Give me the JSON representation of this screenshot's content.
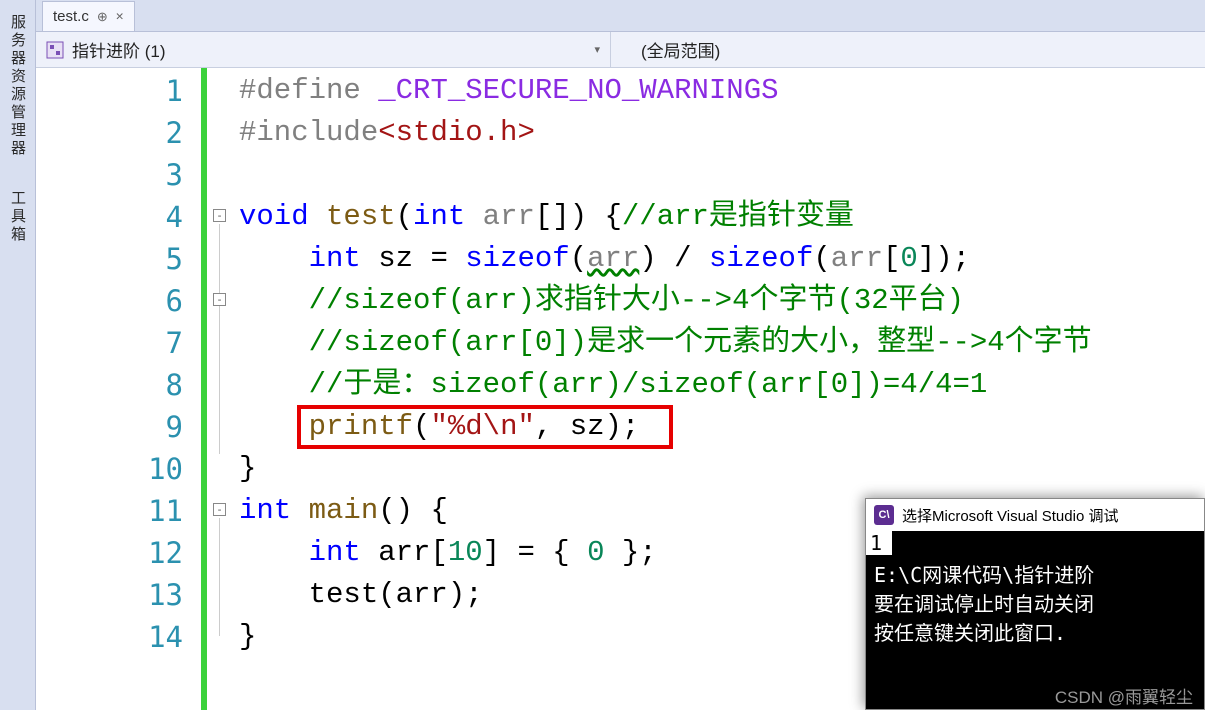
{
  "sidebar": {
    "items": [
      "服务器资源管理器",
      "工具箱"
    ]
  },
  "tab": {
    "filename": "test.c",
    "pin_glyph": "⊕",
    "close_glyph": "✕"
  },
  "navbar": {
    "left": "指针进阶 (1)",
    "right": "(全局范围)"
  },
  "code": {
    "lines": [
      1,
      2,
      3,
      4,
      5,
      6,
      7,
      8,
      9,
      10,
      11,
      12,
      13,
      14
    ],
    "l1": {
      "a": "#define ",
      "b": "_CRT_SECURE_NO_WARNINGS"
    },
    "l2": {
      "a": "#include",
      "b": "<stdio.h>"
    },
    "l4": {
      "a": "void",
      "b": " test",
      "c": "(",
      "d": "int",
      "e": " arr",
      "f": "[]) {",
      "g": "//arr是指针变量"
    },
    "l5": {
      "a": "    ",
      "b": "int",
      "c": " sz = ",
      "d": "sizeof",
      "e": "(",
      "f": "arr",
      "g": ") / ",
      "h": "sizeof",
      "i": "(",
      "j": "arr",
      "k": "[",
      "l": "0",
      "m": "]);"
    },
    "l6": {
      "a": "    ",
      "b": "//sizeof(arr)求指针大小-->4个字节(32平台)"
    },
    "l7": {
      "a": "    ",
      "b": "//sizeof(arr[0])是求一个元素的大小，整型-->4个字节"
    },
    "l8": {
      "a": "    ",
      "b": "//于是：sizeof(arr)/sizeof(arr[0])=4/4=1"
    },
    "l9": {
      "a": "    ",
      "b": "printf",
      "c": "(",
      "d": "\"%d",
      "e": "\\n",
      "f": "\"",
      "g": ", sz);"
    },
    "l10": {
      "a": "}"
    },
    "l11": {
      "a": "int",
      "b": " main",
      "c": "() {"
    },
    "l12": {
      "a": "    ",
      "b": "int",
      "c": " arr[",
      "d": "10",
      "e": "] = { ",
      "f": "0",
      "g": " };"
    },
    "l13": {
      "a": "    test(arr);"
    },
    "l14": {
      "a": "}"
    }
  },
  "console": {
    "title": "选择Microsoft Visual Studio 调试",
    "output": "1",
    "msg1": "E:\\C网课代码\\指针进阶",
    "msg2": "要在调试停止时自动关闭",
    "msg3": "按任意键关闭此窗口."
  },
  "watermark": "CSDN @雨翼轻尘"
}
